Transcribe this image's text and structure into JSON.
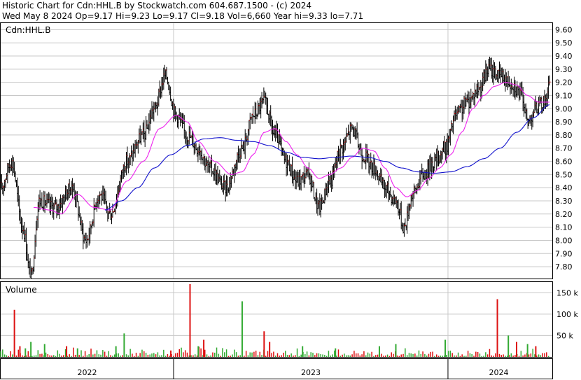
{
  "header": {
    "line1": "Historic Chart for Cdn:HHL.B by Stockwatch.com 604.687.1500  - (c) 2024",
    "line2": "Wed May  8 2024   Op=9.17  Hi=9.23  Lo=9.17  Cl=9.18  Vol=6,660   Year hi=9.33  lo=7.71"
  },
  "symbol_label": "Cdn:HHL.B",
  "volume_label": "Volume",
  "colors": {
    "up_volume": "#33aa33",
    "down_volume": "#dd1111",
    "bar": "#000000",
    "ma_short": "#ee22ee",
    "ma_long": "#1111cc",
    "grid": "#c8c8c8",
    "up_close_dot": "#dd1111"
  },
  "chart_data": [
    {
      "type": "line",
      "subtype": "ohlc",
      "symbol": "Cdn:HHL.B",
      "y_ticks": [
        "9.60",
        "9.50",
        "9.40",
        "9.30",
        "9.20",
        "9.10",
        "9.00",
        "8.90",
        "8.80",
        "8.70",
        "8.60",
        "8.50",
        "8.40",
        "8.30",
        "8.20",
        "8.10",
        "8.00",
        "7.90",
        "7.80"
      ],
      "ylim": [
        7.71,
        9.65
      ],
      "x_labels": [
        "2022",
        "2023",
        "2024"
      ],
      "year_breaks": [
        0.0,
        0.315,
        0.815
      ],
      "price_anchors": [
        [
          0.0,
          8.4
        ],
        [
          0.02,
          8.6
        ],
        [
          0.04,
          8.1
        ],
        [
          0.055,
          7.72
        ],
        [
          0.07,
          8.3
        ],
        [
          0.1,
          8.25
        ],
        [
          0.13,
          8.4
        ],
        [
          0.155,
          8.0
        ],
        [
          0.18,
          8.35
        ],
        [
          0.2,
          8.2
        ],
        [
          0.23,
          8.6
        ],
        [
          0.26,
          8.8
        ],
        [
          0.28,
          9.0
        ],
        [
          0.3,
          9.25
        ],
        [
          0.32,
          8.95
        ],
        [
          0.34,
          8.8
        ],
        [
          0.36,
          8.7
        ],
        [
          0.38,
          8.55
        ],
        [
          0.41,
          8.4
        ],
        [
          0.44,
          8.7
        ],
        [
          0.46,
          8.95
        ],
        [
          0.48,
          9.05
        ],
        [
          0.5,
          8.8
        ],
        [
          0.52,
          8.6
        ],
        [
          0.54,
          8.45
        ],
        [
          0.56,
          8.5
        ],
        [
          0.58,
          8.25
        ],
        [
          0.6,
          8.45
        ],
        [
          0.62,
          8.7
        ],
        [
          0.64,
          8.85
        ],
        [
          0.66,
          8.65
        ],
        [
          0.68,
          8.55
        ],
        [
          0.7,
          8.4
        ],
        [
          0.72,
          8.3
        ],
        [
          0.735,
          8.1
        ],
        [
          0.75,
          8.35
        ],
        [
          0.77,
          8.5
        ],
        [
          0.79,
          8.6
        ],
        [
          0.81,
          8.7
        ],
        [
          0.83,
          8.95
        ],
        [
          0.85,
          9.05
        ],
        [
          0.87,
          9.15
        ],
        [
          0.89,
          9.3
        ],
        [
          0.91,
          9.25
        ],
        [
          0.93,
          9.2
        ],
        [
          0.95,
          9.1
        ],
        [
          0.96,
          8.9
        ],
        [
          0.975,
          9.0
        ],
        [
          0.99,
          9.05
        ],
        [
          1.0,
          9.18
        ]
      ],
      "ma_short_anchors": [
        [
          0.06,
          8.25
        ],
        [
          0.09,
          8.23
        ],
        [
          0.11,
          8.2
        ],
        [
          0.14,
          8.35
        ],
        [
          0.17,
          8.25
        ],
        [
          0.2,
          8.23
        ],
        [
          0.23,
          8.45
        ],
        [
          0.26,
          8.6
        ],
        [
          0.29,
          8.85
        ],
        [
          0.32,
          8.95
        ],
        [
          0.34,
          8.9
        ],
        [
          0.36,
          8.75
        ],
        [
          0.39,
          8.6
        ],
        [
          0.42,
          8.5
        ],
        [
          0.44,
          8.52
        ],
        [
          0.46,
          8.65
        ],
        [
          0.48,
          8.82
        ],
        [
          0.5,
          8.85
        ],
        [
          0.52,
          8.75
        ],
        [
          0.54,
          8.65
        ],
        [
          0.56,
          8.55
        ],
        [
          0.58,
          8.47
        ],
        [
          0.6,
          8.5
        ],
        [
          0.62,
          8.55
        ],
        [
          0.64,
          8.63
        ],
        [
          0.66,
          8.7
        ],
        [
          0.68,
          8.68
        ],
        [
          0.7,
          8.55
        ],
        [
          0.72,
          8.4
        ],
        [
          0.74,
          8.33
        ],
        [
          0.76,
          8.38
        ],
        [
          0.78,
          8.47
        ],
        [
          0.8,
          8.55
        ],
        [
          0.82,
          8.65
        ],
        [
          0.84,
          8.82
        ],
        [
          0.86,
          9.0
        ],
        [
          0.88,
          9.1
        ],
        [
          0.9,
          9.17
        ],
        [
          0.92,
          9.2
        ],
        [
          0.94,
          9.18
        ],
        [
          0.96,
          9.1
        ],
        [
          0.98,
          9.05
        ],
        [
          1.0,
          9.05
        ]
      ],
      "ma_long_anchors": [
        [
          0.19,
          8.23
        ],
        [
          0.22,
          8.3
        ],
        [
          0.25,
          8.4
        ],
        [
          0.28,
          8.55
        ],
        [
          0.31,
          8.65
        ],
        [
          0.34,
          8.72
        ],
        [
          0.37,
          8.77
        ],
        [
          0.4,
          8.78
        ],
        [
          0.43,
          8.76
        ],
        [
          0.46,
          8.75
        ],
        [
          0.49,
          8.72
        ],
        [
          0.52,
          8.67
        ],
        [
          0.55,
          8.63
        ],
        [
          0.58,
          8.62
        ],
        [
          0.61,
          8.63
        ],
        [
          0.64,
          8.64
        ],
        [
          0.67,
          8.63
        ],
        [
          0.7,
          8.6
        ],
        [
          0.73,
          8.55
        ],
        [
          0.76,
          8.52
        ],
        [
          0.79,
          8.51
        ],
        [
          0.82,
          8.52
        ],
        [
          0.85,
          8.56
        ],
        [
          0.88,
          8.62
        ],
        [
          0.91,
          8.7
        ],
        [
          0.94,
          8.82
        ],
        [
          0.97,
          8.93
        ],
        [
          1.0,
          9.03
        ]
      ]
    },
    {
      "type": "bar",
      "title": "Volume",
      "y_ticks": [
        "150 k",
        "100 k",
        "50 k"
      ],
      "ylim": [
        0,
        175000
      ],
      "spikes": [
        [
          0.025,
          110000,
          "down"
        ],
        [
          0.035,
          25000,
          "down"
        ],
        [
          0.045,
          20000,
          "up"
        ],
        [
          0.055,
          35000,
          "up"
        ],
        [
          0.08,
          30000,
          "up"
        ],
        [
          0.12,
          25000,
          "down"
        ],
        [
          0.14,
          20000,
          "up"
        ],
        [
          0.21,
          25000,
          "up"
        ],
        [
          0.225,
          55000,
          "up"
        ],
        [
          0.31,
          15000,
          "down"
        ],
        [
          0.345,
          170000,
          "down"
        ],
        [
          0.36,
          25000,
          "up"
        ],
        [
          0.37,
          40000,
          "down"
        ],
        [
          0.44,
          130000,
          "up"
        ],
        [
          0.48,
          60000,
          "down"
        ],
        [
          0.49,
          35000,
          "down"
        ],
        [
          0.55,
          25000,
          "up"
        ],
        [
          0.61,
          20000,
          "up"
        ],
        [
          0.69,
          25000,
          "up"
        ],
        [
          0.72,
          30000,
          "up"
        ],
        [
          0.81,
          40000,
          "up"
        ],
        [
          0.905,
          135000,
          "down"
        ],
        [
          0.925,
          50000,
          "up"
        ],
        [
          0.94,
          35000,
          "down"
        ],
        [
          0.96,
          30000,
          "up"
        ],
        [
          0.975,
          25000,
          "down"
        ]
      ]
    }
  ]
}
